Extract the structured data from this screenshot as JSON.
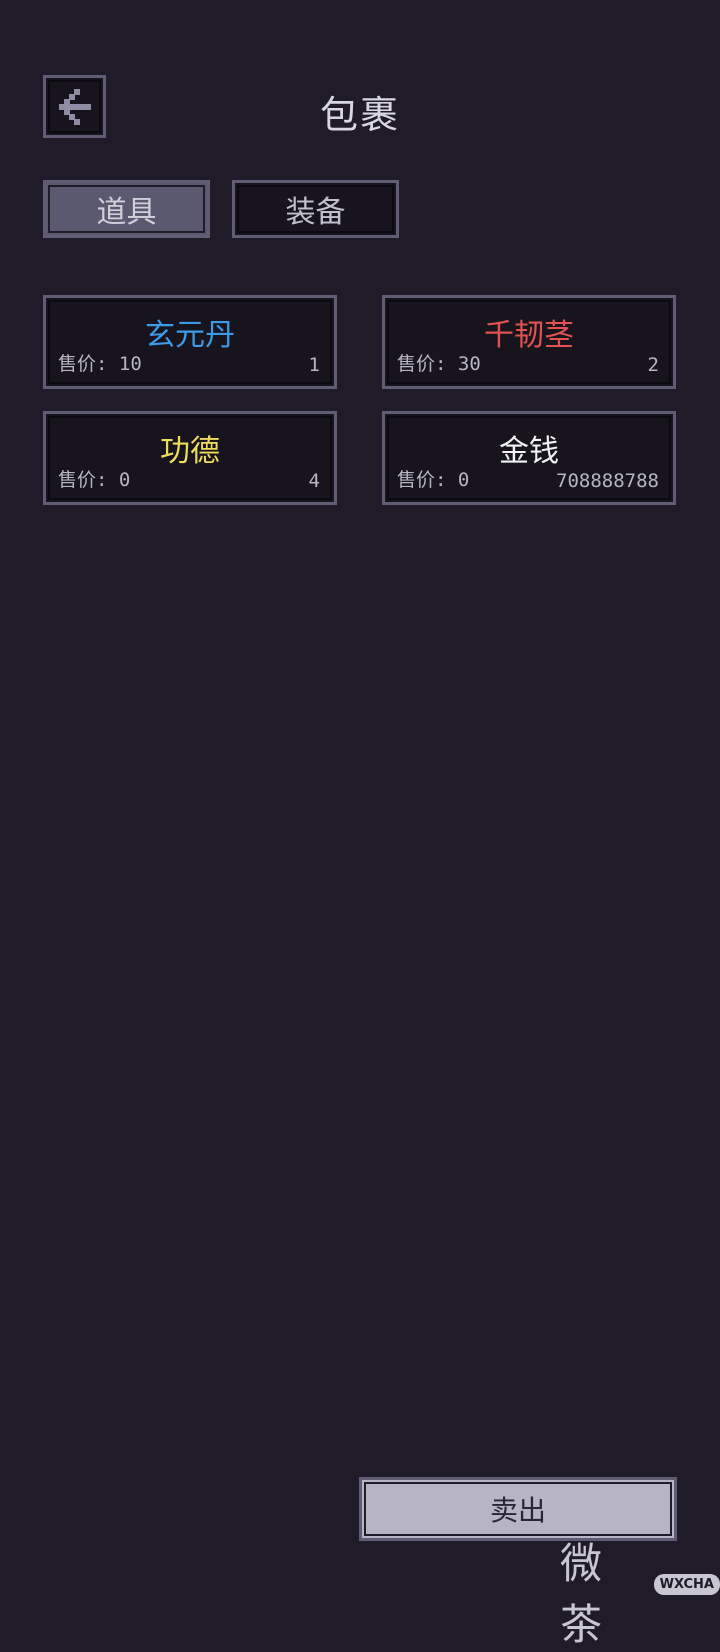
{
  "header": {
    "title": "包裹",
    "back_icon": "arrow-left-icon"
  },
  "tabs": [
    {
      "label": "道具",
      "active": true
    },
    {
      "label": "装备",
      "active": false
    }
  ],
  "items": [
    {
      "name": "玄元丹",
      "price": "售价: 10",
      "count": "1",
      "color": "#3b9be8"
    },
    {
      "name": "千韧茎",
      "price": "售价: 30",
      "count": "2",
      "color": "#e35252"
    },
    {
      "name": "功德",
      "price": "售价: 0",
      "count": "4",
      "color": "#efdc5a"
    },
    {
      "name": "金钱",
      "price": "售价: 0",
      "count": "708888788",
      "color": "#f2f2f2"
    }
  ],
  "actions": {
    "sell_label": "卖出"
  },
  "watermark": {
    "text": "微茶",
    "badge": "WXCHA"
  }
}
